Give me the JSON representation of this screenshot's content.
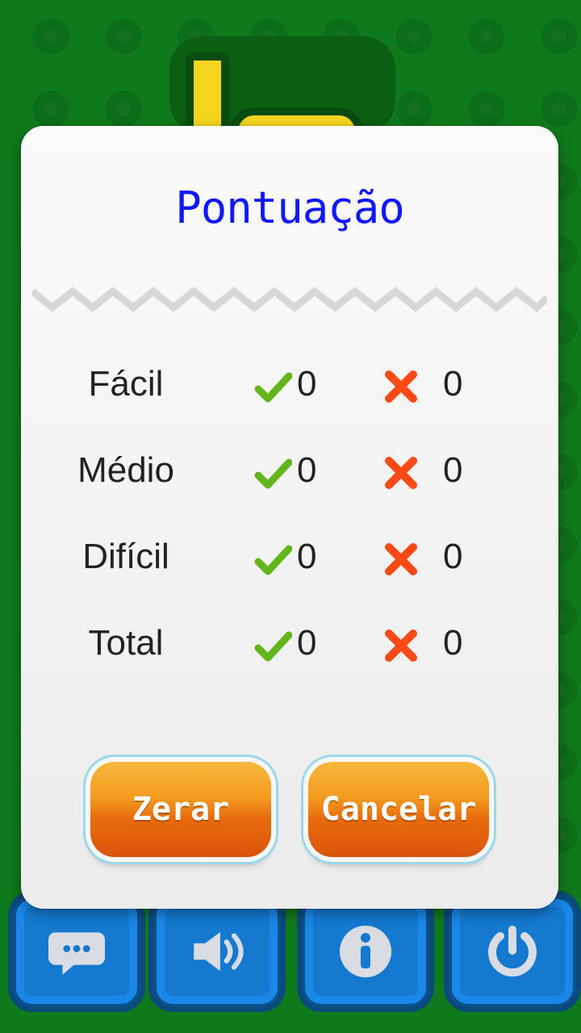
{
  "dialog": {
    "title": "Pontuação",
    "rows": [
      {
        "label": "Fácil",
        "correct": "0",
        "wrong": "0"
      },
      {
        "label": "Médio",
        "correct": "0",
        "wrong": "0"
      },
      {
        "label": "Difícil",
        "correct": "0",
        "wrong": "0"
      },
      {
        "label": "Total",
        "correct": "0",
        "wrong": "0"
      }
    ],
    "buttons": {
      "reset": "Zerar",
      "cancel": "Cancelar"
    }
  },
  "toolbar": {
    "icons": [
      "chat-icon",
      "sound-icon",
      "info-icon",
      "power-icon"
    ]
  },
  "colors": {
    "background": "#0f7a1c",
    "title": "#1118ff",
    "check": "#63b51c",
    "cross": "#ff4a17",
    "button_orange": "#f39a1e"
  }
}
